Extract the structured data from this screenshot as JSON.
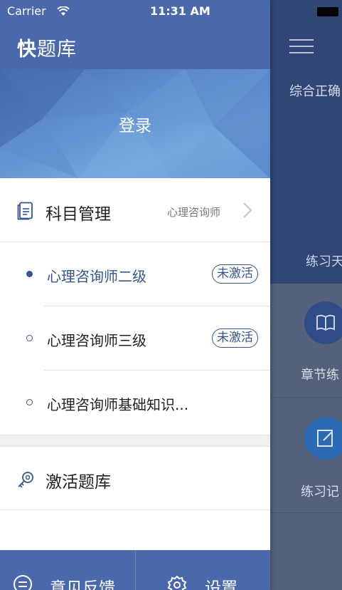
{
  "status_bar": {
    "carrier": "Carrier",
    "time": "11:31 AM"
  },
  "drawer": {
    "app_title_bold": "快",
    "app_title_rest": "题库",
    "login_label": "登录",
    "subject": {
      "label": "科目管理",
      "current_value": "心理咨询师"
    },
    "subject_items": [
      {
        "label": "心理咨询师二级",
        "badge": "未激活",
        "selected": true
      },
      {
        "label": "心理咨询师三级",
        "badge": "未激活",
        "selected": false
      },
      {
        "label": "心理咨询师基础知识...",
        "badge": "",
        "selected": false
      }
    ],
    "activate_label": "激活题库",
    "footer": {
      "feedback_label": "意见反馈",
      "settings_label": "设置"
    }
  },
  "background_page": {
    "title_partial": "综合正确",
    "subtitle_partial": "练习天",
    "cards": [
      {
        "label": "章节练",
        "icon": "book-icon"
      },
      {
        "label": "练习记",
        "icon": "edit-icon"
      }
    ]
  },
  "colors": {
    "drawer_header": "#4a68ac",
    "accent": "#35558f",
    "bg_header": "#2f4676",
    "bg_lower": "#55617a"
  }
}
